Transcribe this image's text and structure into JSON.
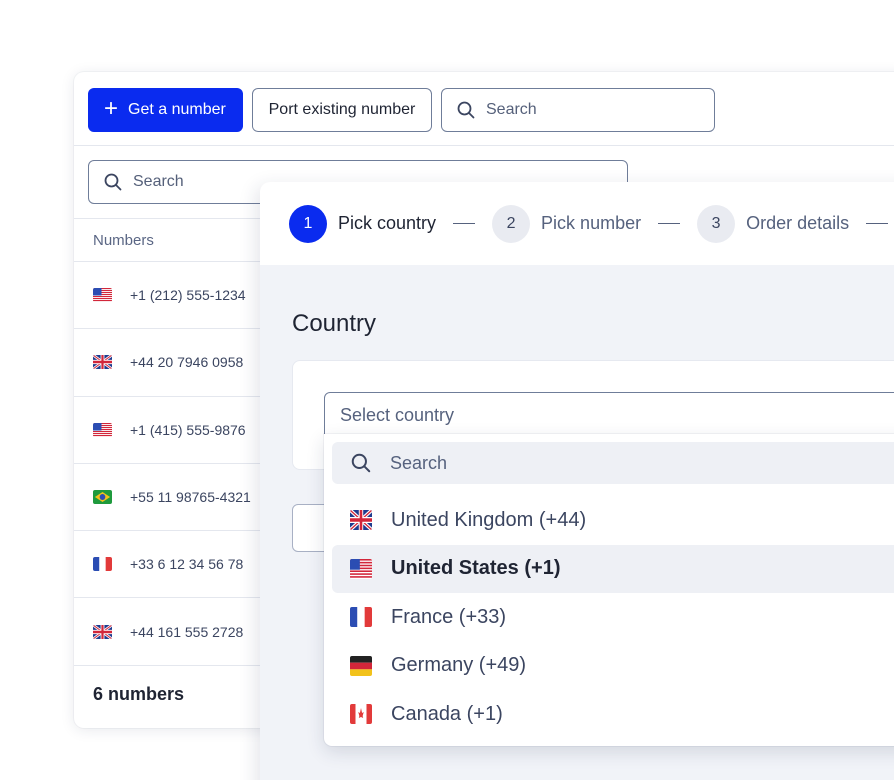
{
  "toolbar": {
    "get_number_label": "Get a number",
    "port_label": "Port existing number",
    "search_placeholder": "Search"
  },
  "list": {
    "search_placeholder": "Search",
    "column_header": "Numbers",
    "rows": [
      {
        "flag": "us",
        "number": "+1 (212) 555-1234"
      },
      {
        "flag": "gb",
        "number": "+44 20 7946 0958"
      },
      {
        "flag": "us",
        "number": "+1 (415) 555-9876"
      },
      {
        "flag": "br",
        "number": "+55 11 98765-4321"
      },
      {
        "flag": "fr",
        "number": "+33 6 12 34 56 78"
      },
      {
        "flag": "gb",
        "number": "+44 161 555 2728"
      }
    ],
    "footer_count": "6 numbers"
  },
  "wizard": {
    "steps": [
      {
        "num": "1",
        "label": "Pick country",
        "active": true
      },
      {
        "num": "2",
        "label": "Pick number",
        "active": false
      },
      {
        "num": "3",
        "label": "Order details",
        "active": false
      }
    ],
    "section_title": "Country",
    "select_placeholder": "Select country",
    "dropdown_search_placeholder": "Search",
    "options": [
      {
        "flag": "gb",
        "label": "United Kingdom (+44)",
        "selected": false
      },
      {
        "flag": "us",
        "label": "United States (+1)",
        "selected": true
      },
      {
        "flag": "fr",
        "label": "France (+33)",
        "selected": false
      },
      {
        "flag": "de",
        "label": "Germany (+49)",
        "selected": false
      },
      {
        "flag": "ca",
        "label": "Canada (+1)",
        "selected": false
      }
    ]
  },
  "colors": {
    "primary": "#0a2bef",
    "border": "#6f7d99",
    "panel_bg": "#f1f3f8"
  },
  "icons": [
    "plus-icon",
    "search-icon",
    "flag-icon"
  ]
}
